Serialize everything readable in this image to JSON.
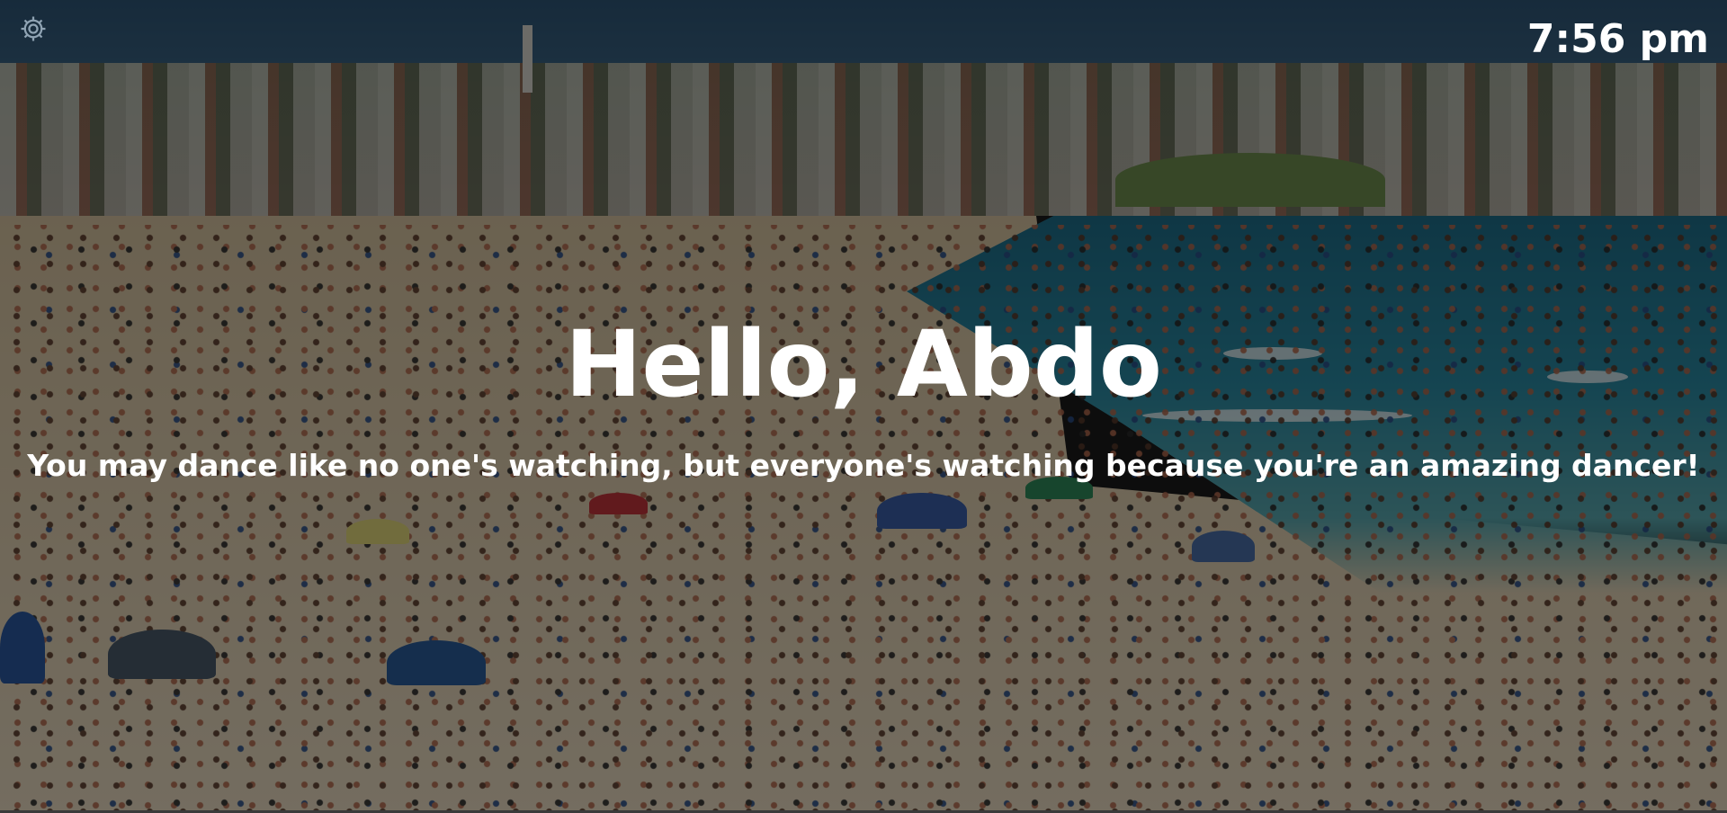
{
  "app": {
    "time": "7:56 pm",
    "greeting": "Hello, Abdo",
    "quote": "You may dance like no one's watching, but everyone's watching because you're an amazing dancer!"
  },
  "settings": {
    "icon": "gear-icon"
  },
  "background": {
    "subject": "crowded beach photo",
    "overlay_color": "#000000",
    "text_color": "#ffffff"
  }
}
